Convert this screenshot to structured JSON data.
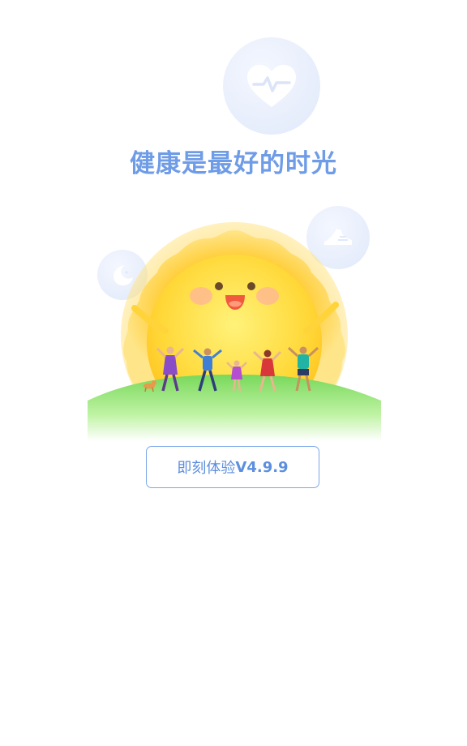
{
  "splash": {
    "title": "健康是最好的时光",
    "button_prefix": "即刻体验",
    "button_version": "V4.9.9"
  },
  "icons": {
    "heart": "heart-pulse-icon",
    "shoe": "running-shoe-icon",
    "moon": "moon-sleep-icon"
  },
  "colors": {
    "accent": "#6f9ce6",
    "button_border": "#7aa7ea",
    "sun": "#ffd43b",
    "grass": "#8ee26a",
    "bubble": "#e6edfb"
  }
}
